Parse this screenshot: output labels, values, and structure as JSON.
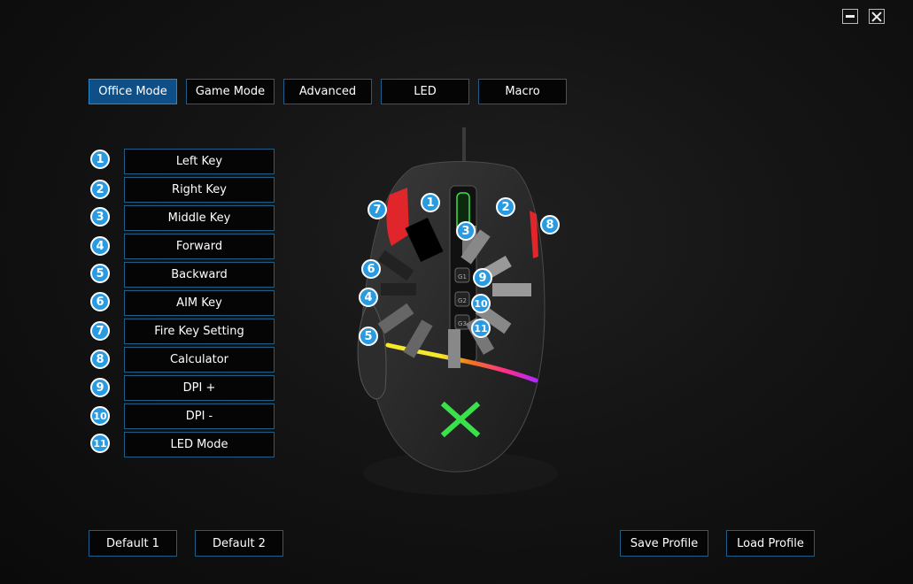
{
  "window": {
    "minimize_icon": "minimize-icon",
    "close_icon": "close-icon"
  },
  "tabs": [
    {
      "label": "Office Mode",
      "active": true
    },
    {
      "label": "Game Mode",
      "active": false
    },
    {
      "label": "Advanced",
      "active": false
    },
    {
      "label": "LED",
      "active": false
    },
    {
      "label": "Macro",
      "active": false
    }
  ],
  "keys": [
    {
      "num": "1",
      "label": "Left Key"
    },
    {
      "num": "2",
      "label": "Right Key"
    },
    {
      "num": "3",
      "label": "Middle Key"
    },
    {
      "num": "4",
      "label": "Forward"
    },
    {
      "num": "5",
      "label": "Backward"
    },
    {
      "num": "6",
      "label": "AIM Key"
    },
    {
      "num": "7",
      "label": "Fire Key Setting"
    },
    {
      "num": "8",
      "label": "Calculator"
    },
    {
      "num": "9",
      "label": "DPI +"
    },
    {
      "num": "10",
      "label": "DPI -"
    },
    {
      "num": "11",
      "label": "LED Mode"
    }
  ],
  "mouse": {
    "side_labels": [
      "G1",
      "G2",
      "G3"
    ],
    "logo": "X",
    "callouts": [
      "1",
      "2",
      "3",
      "4",
      "5",
      "6",
      "7",
      "8",
      "9",
      "10",
      "11"
    ]
  },
  "bottom": {
    "default1": "Default 1",
    "default2": "Default 2",
    "save_profile": "Save Profile",
    "load_profile": "Load Profile"
  },
  "colors": {
    "accent": "#2a9be0",
    "border": "#1e5f8a",
    "active_tab": "#0d4f86",
    "red_button": "#e0252b",
    "logo_green": "#39e14a"
  }
}
